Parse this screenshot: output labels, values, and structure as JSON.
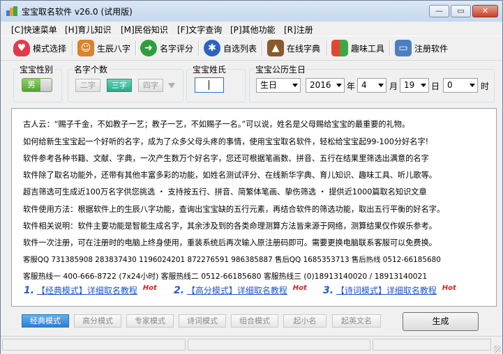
{
  "window": {
    "title": "宝宝取名软件 v26.0 (试用版)",
    "controls": [
      "—",
      "▭",
      "✕"
    ]
  },
  "menu": [
    "[C]快速菜单",
    "[H]育儿知识",
    "[M]民俗知识",
    "[F]文字查询",
    "[P]其他功能",
    "[R]注册"
  ],
  "toolbar": [
    {
      "label": "模式选择",
      "icon": "heart-icon",
      "color": "#e23a4d"
    },
    {
      "label": "生辰八字",
      "icon": "people-icon",
      "color": "#d9832b"
    },
    {
      "label": "名字评分",
      "icon": "arrow-right-icon",
      "color": "#2e9f3a"
    },
    {
      "label": "自选列表",
      "icon": "globe-icon",
      "color": "#2b63c2"
    },
    {
      "label": "在线字典",
      "icon": "graduate-icon",
      "color": "#8a5a2b"
    },
    {
      "label": "趣味工具",
      "icon": "windows-icon",
      "color": "#3a8fd8"
    },
    {
      "label": "注册软件",
      "icon": "monitor-icon",
      "color": "#4a7fc2"
    }
  ],
  "options": {
    "gender_title": "宝宝性别",
    "gender_value": "男",
    "count_title": "名字个数",
    "count_options": [
      "二字",
      "三字",
      "四字"
    ],
    "count_selected": "三字",
    "surname_title": "宝宝姓氏",
    "surname_value": "",
    "birth_title": "宝宝公历生日",
    "birth_type": "生日",
    "year": "2016",
    "year_unit": "年",
    "month": "4",
    "month_unit": "月",
    "day": "19",
    "day_unit": "日",
    "hour": "0",
    "hour_unit": "时"
  },
  "intro_lines": [
    "古人云：“赐子千金，不如教子一艺；教子一艺，不如赐子一名。”可以说，姓名是父母赐给宝宝的最重要的礼物。",
    "如何给新生宝宝起一个好听的名字，成为了众多父母头疼的事情，使用宝宝取名软件，轻松给宝宝起99-100分好名字!",
    "软件参考各种书籍、文献、字典，一次产生数万个好名字，您还可根据笔画数、拼音、五行在结果里筛选出满意的名字",
    "软件除了取名功能外，还带有其他丰富多彩的功能，如姓名测试评分、在线新华字典、育儿知识、趣味工具、听儿歌等。",
    "超吉筛选可生成近100万名字供您挑选 ・ 支持按五行、拼音、简繁体笔画、挚伤筛选 ・ 提供近1000篇取名知识文章",
    "软件使用方法：根据软件上的生辰八字功能，查询出宝宝缺的五行元素，再结合软件的筛选功能，取出五行平衡的好名字。",
    "软件相关说明：软件主要功能是智能生成名字，其余涉及到的各类命理测算方法皆来源于网络，测算结果仅作娱乐参考。",
    "软件一次注册，可在注册时的电脑上终身使用，重装系统后再次输入原注册码即可。需要更换电脑联系客服可以免费换。",
    "客服QQ 731385908  283837430  1196024201  872276591  986385887   售后QQ 1685353713   售后热线 0512-66185680",
    "客服热线一 400-666-8722 (7x24小时)  客服热线二 0512-66185680  客服热线三 (0)18913140020 / 18913140021"
  ],
  "tutorials": [
    {
      "num": "1.",
      "text": "【经典模式】详细取名教程",
      "hot": "Hot"
    },
    {
      "num": "2.",
      "text": "【高分模式】详细取名教程",
      "hot": "Hot"
    },
    {
      "num": "3.",
      "text": "【诗词模式】详细取名教程",
      "hot": "Hot"
    }
  ],
  "modes": [
    "经典模式",
    "高分模式",
    "专家模式",
    "诗词模式",
    "组合模式",
    "起小名",
    "起英文名"
  ],
  "mode_selected": "经典模式",
  "generate_label": "生成"
}
